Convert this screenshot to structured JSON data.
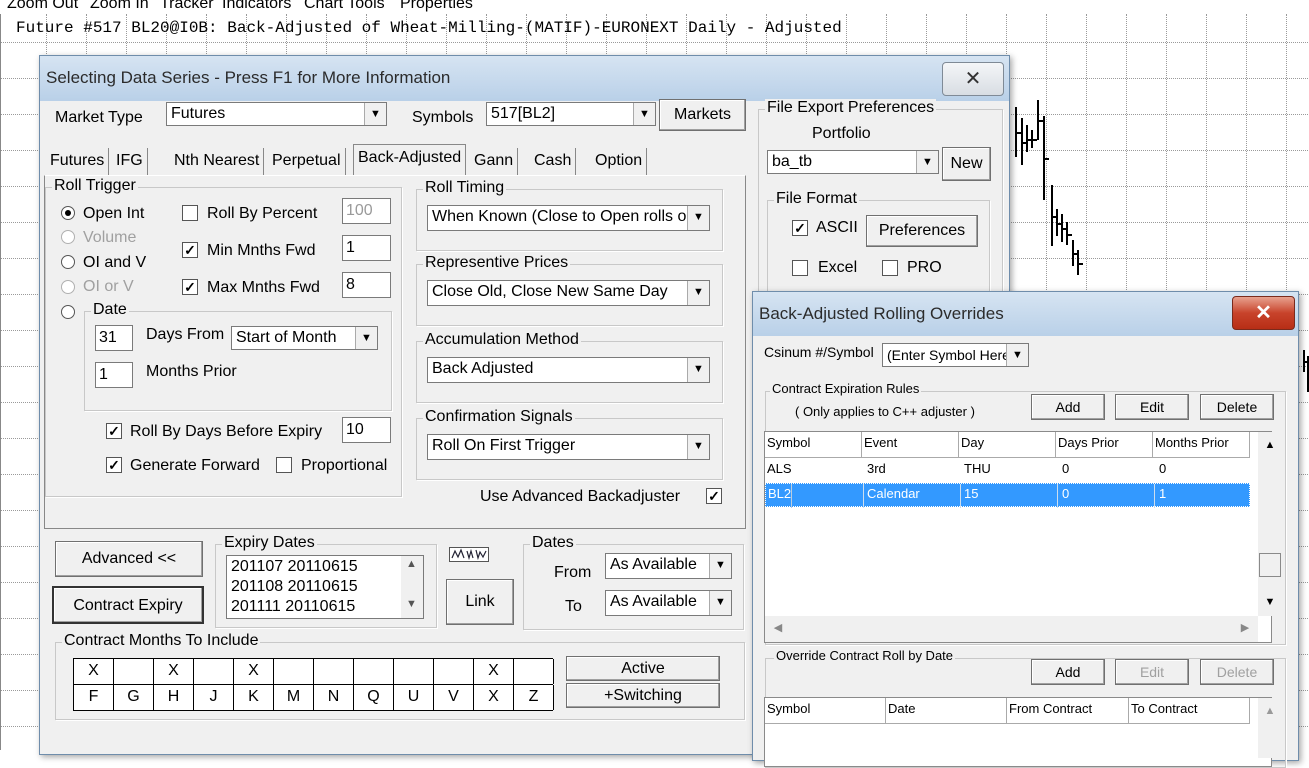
{
  "menubar": {
    "items": [
      "Zoom Out",
      "Zoom In",
      "Tracker",
      "Indicators",
      "Chart Tools",
      "Properties"
    ]
  },
  "chart": {
    "title": "Future #517 BL20@I0B: Back-Adjusted of Wheat-Milling-(MATIF)-EURONEXT Daily -  Adjusted"
  },
  "dialog": {
    "title": "Selecting Data Series - Press F1 for More Information",
    "close_glyph": "✕",
    "market_type_label": "Market Type",
    "market_type_value": "Futures",
    "symbols_label": "Symbols",
    "symbols_value": "517[BL2]",
    "markets_button": "Markets",
    "tabs": [
      "Futures",
      "IFG",
      "Nth Nearest",
      "Perpetual",
      "Back-Adjusted",
      "Gann",
      "Cash",
      "Option"
    ],
    "roll_trigger": {
      "caption": "Roll Trigger",
      "open_int": "Open Int",
      "volume": "Volume",
      "oi_and_v": "OI and V",
      "oi_or_v": "OI or V",
      "date": "Date",
      "roll_by_percent": "Roll By Percent",
      "roll_by_percent_value": "100",
      "min_mnths_fwd": "Min Mnths Fwd",
      "min_mnths_fwd_value": "1",
      "max_mnths_fwd": "Max Mnths Fwd",
      "max_mnths_fwd_value": "8",
      "days_value": "31",
      "days_from_label": "Days From",
      "days_from_value": "Start of Month",
      "months_prior_value": "1",
      "months_prior_label": "Months Prior",
      "roll_by_days_label": "Roll By Days Before Expiry",
      "roll_by_days_value": "10",
      "generate_forward": "Generate Forward",
      "proportional": "Proportional"
    },
    "roll_timing": {
      "caption": "Roll Timing",
      "value": "When Known (Close to Open rolls or"
    },
    "representive_prices": {
      "caption": "Representive Prices",
      "value": "Close Old, Close New Same Day"
    },
    "accumulation_method": {
      "caption": "Accumulation Method",
      "value": "Back Adjusted"
    },
    "confirmation_signals": {
      "caption": "Confirmation Signals",
      "value": "Roll On First Trigger"
    },
    "use_advanced_label": "Use Advanced Backadjuster",
    "advanced_button": "Advanced <<",
    "contract_expiry_button": "Contract Expiry",
    "expiry_dates": {
      "caption": "Expiry Dates",
      "rows": [
        "201107  20110615",
        "201108  20110615",
        "201111  20110615"
      ]
    },
    "link_button": "Link",
    "dates": {
      "caption": "Dates",
      "from_label": "From",
      "from_value": "As Available",
      "to_label": "To",
      "to_value": "As Available"
    },
    "contract_months": {
      "caption": "Contract Months To Include",
      "marks": [
        "X",
        "",
        "X",
        "",
        "X",
        "",
        "",
        "",
        "",
        "",
        "X",
        ""
      ],
      "letters": [
        "F",
        "G",
        "H",
        "J",
        "K",
        "M",
        "N",
        "Q",
        "U",
        "V",
        "X",
        "Z"
      ]
    },
    "active_button": "Active",
    "switching_button": "+Switching"
  },
  "file_export": {
    "caption": "File Export Preferences",
    "portfolio_label": "Portfolio",
    "portfolio_value": "ba_tb",
    "new_button": "New",
    "file_format_caption": "File Format",
    "ascii": "ASCII",
    "preferences_button": "Preferences",
    "excel": "Excel",
    "pro": "PRO"
  },
  "overrides": {
    "title": "Back-Adjusted Rolling Overrides",
    "close_glyph": "✕",
    "csinum_label": "Csinum #/Symbol",
    "csinum_value": "(Enter Symbol Here",
    "expiration_caption": "Contract Expiration Rules",
    "expiration_note": "( Only applies to C++ adjuster )",
    "add_button": "Add",
    "edit_button": "Edit",
    "delete_button": "Delete",
    "columns": [
      "Symbol",
      "Event",
      "Day",
      "Days Prior",
      "Months Prior"
    ],
    "rows": [
      [
        "ALS",
        "3rd",
        "THU",
        "0",
        "0"
      ],
      [
        "BL2",
        "Calendar",
        "15",
        "0",
        "1"
      ]
    ],
    "override_caption": "Override Contract Roll by Date",
    "override_add": "Add",
    "override_edit": "Edit",
    "override_delete": "Delete",
    "override_columns": [
      "Symbol",
      "Date",
      "From Contract",
      "To Contract"
    ]
  }
}
